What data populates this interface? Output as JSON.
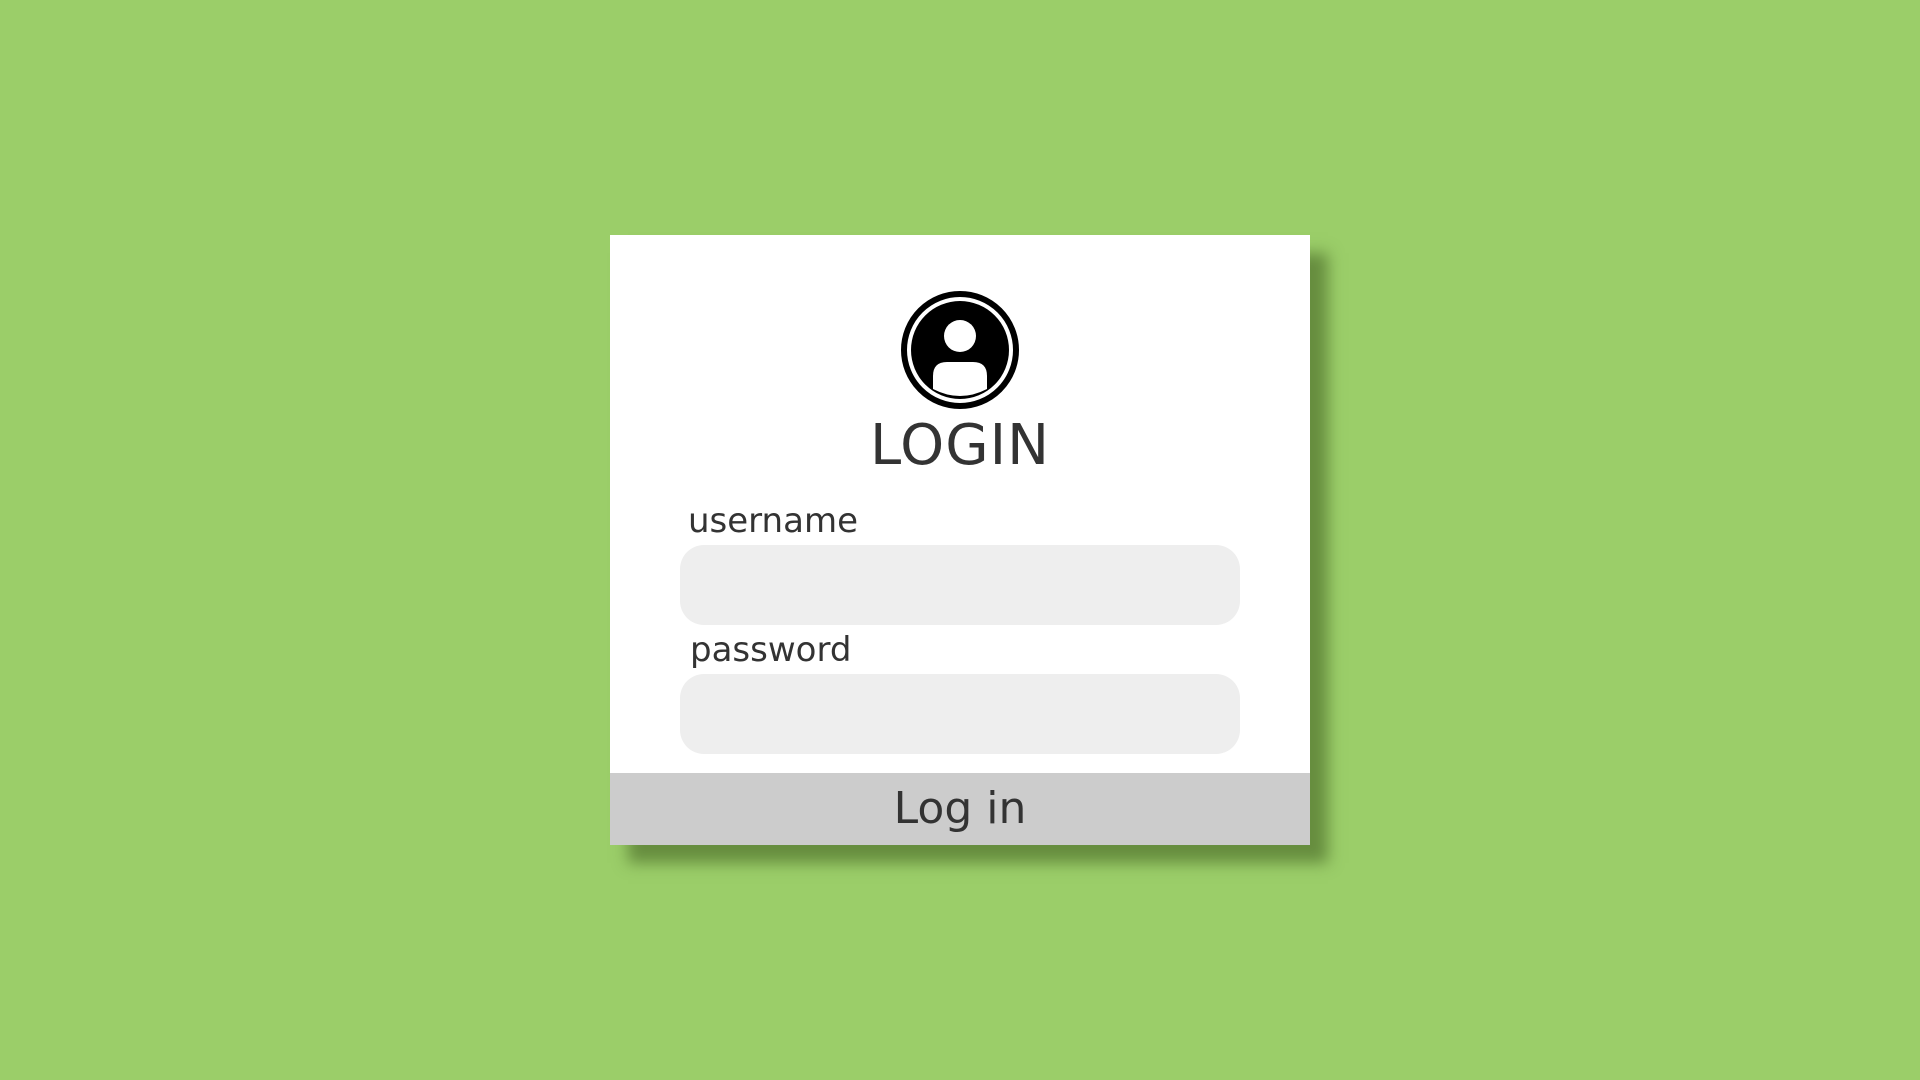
{
  "colors": {
    "background": "#9bce69",
    "card": "#ffffff",
    "input": "#eeeeee",
    "button": "#cccccc",
    "text": "#333333"
  },
  "login": {
    "icon": "user-circle-icon",
    "title": "LOGIN",
    "username_label": "username",
    "username_value": "",
    "password_label": "password",
    "password_value": "",
    "submit_label": "Log in"
  }
}
